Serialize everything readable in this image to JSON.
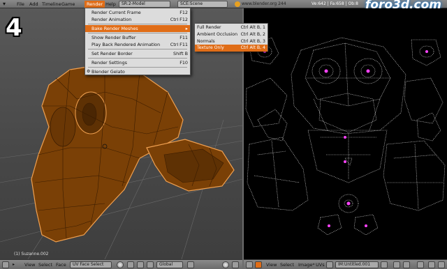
{
  "header": {
    "menu": [
      "File",
      "Add",
      "Timeline",
      "Game",
      "Render",
      "Help"
    ],
    "screen_field": "SR:2-Model",
    "scene_field": "SCE:Scene",
    "url": "www.blender.org 244",
    "stats": "Ve:642 | Fa:658 | Ob:8",
    "watermark": "foro3d.com"
  },
  "viewport": {
    "step_number": "4",
    "object_label": "(1) Suzanne.002",
    "colors": {
      "mesh_fill": "#7a4006",
      "mesh_wire": "#3a1c02",
      "mesh_edge_highlight": "#f0a050"
    }
  },
  "render_menu": {
    "items": [
      {
        "label": "Render Current Frame",
        "shortcut": "F12"
      },
      {
        "label": "Render Animation",
        "shortcut": "Ctrl F12"
      },
      {
        "label": "Bake Render Meshes",
        "shortcut": "",
        "highlighted": true
      },
      {
        "label": "Show Render Buffer",
        "shortcut": "F11"
      },
      {
        "label": "Play Back Rendered Animation",
        "shortcut": "Ctrl F11"
      },
      {
        "label": "Set Render Border",
        "shortcut": "Shift B"
      },
      {
        "label": "Render Settings",
        "shortcut": "F10"
      },
      {
        "label": "Blender Gelato",
        "shortcut": ""
      }
    ]
  },
  "bake_submenu": {
    "items": [
      {
        "label": "Full Render",
        "shortcut": "Ctrl Alt B, 1"
      },
      {
        "label": "Ambient Occlusion",
        "shortcut": "Ctrl Alt B, 2"
      },
      {
        "label": "Normals",
        "shortcut": "Ctrl Alt B, 3"
      },
      {
        "label": "Texture Only",
        "shortcut": "Ctrl Alt B, 4",
        "highlighted": true
      }
    ]
  },
  "bottom_left": {
    "items": [
      "View",
      "Select",
      "Face"
    ],
    "mode": "UV Face Select",
    "pivot": "Global"
  },
  "bottom_right": {
    "items": [
      "View",
      "Select",
      "Image*",
      "UVs"
    ],
    "image_name": "IM:Untitled.001"
  },
  "colors": {
    "accent": "#e06d17",
    "uv_wire": "#ffffff",
    "uv_vertex": "#ff44ff"
  }
}
